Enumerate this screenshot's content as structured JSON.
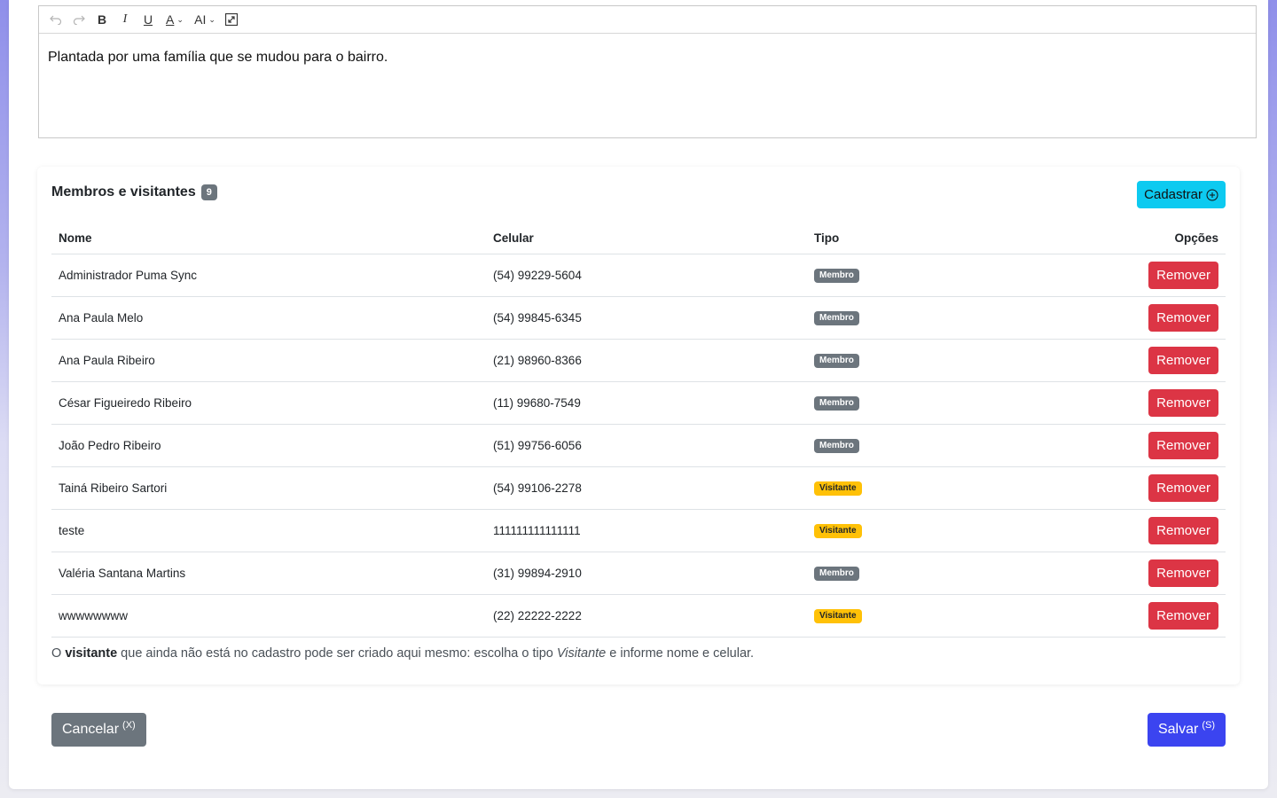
{
  "editor": {
    "toolbar": {
      "undo_icon": "undo-icon",
      "redo_icon": "redo-icon",
      "bold": "B",
      "italic": "I",
      "underline": "U",
      "font_color": "A",
      "font_size": "AI"
    },
    "content": "Plantada por uma família que se mudou para o bairro."
  },
  "members": {
    "title": "Membros e visitantes",
    "count": "9",
    "add_button": "Cadastrar",
    "columns": {
      "nome": "Nome",
      "celular": "Celular",
      "tipo": "Tipo",
      "opcoes": "Opções"
    },
    "rows": [
      {
        "nome": "Administrador Puma Sync",
        "celular": "(54) 99229-5604",
        "tipo": "Membro",
        "action": "Remover"
      },
      {
        "nome": "Ana Paula Melo",
        "celular": "(54) 99845-6345",
        "tipo": "Membro",
        "action": "Remover"
      },
      {
        "nome": "Ana Paula Ribeiro",
        "celular": "(21) 98960-8366",
        "tipo": "Membro",
        "action": "Remover"
      },
      {
        "nome": "César Figueiredo Ribeiro",
        "celular": "(11) 99680-7549",
        "tipo": "Membro",
        "action": "Remover"
      },
      {
        "nome": "João Pedro Ribeiro",
        "celular": "(51) 99756-6056",
        "tipo": "Membro",
        "action": "Remover"
      },
      {
        "nome": "Tainá Ribeiro Sartori",
        "celular": "(54) 99106-2278",
        "tipo": "Visitante",
        "action": "Remover"
      },
      {
        "nome": "teste",
        "celular": "111111111111111",
        "tipo": "Visitante",
        "action": "Remover"
      },
      {
        "nome": "Valéria Santana Martins",
        "celular": "(31) 99894-2910",
        "tipo": "Membro",
        "action": "Remover"
      },
      {
        "nome": "wwwwwwww",
        "celular": "(22) 22222-2222",
        "tipo": "Visitante",
        "action": "Remover"
      }
    ],
    "note": {
      "part1": "O ",
      "bold": "visitante",
      "part2": " que ainda não está no cadastro pode ser criado aqui mesmo: escolha o tipo ",
      "italic": "Visitante",
      "part3": " e informe nome e celular."
    }
  },
  "footer": {
    "cancel_label": "Cancelar",
    "cancel_shortcut": "(X)",
    "save_label": "Salvar",
    "save_shortcut": "(S)"
  },
  "colors": {
    "remove": "#dc3545",
    "add": "#0dcaf0",
    "save": "#3b44f0",
    "membro_badge": "#6c757d",
    "visitante_badge": "#ffc107"
  }
}
